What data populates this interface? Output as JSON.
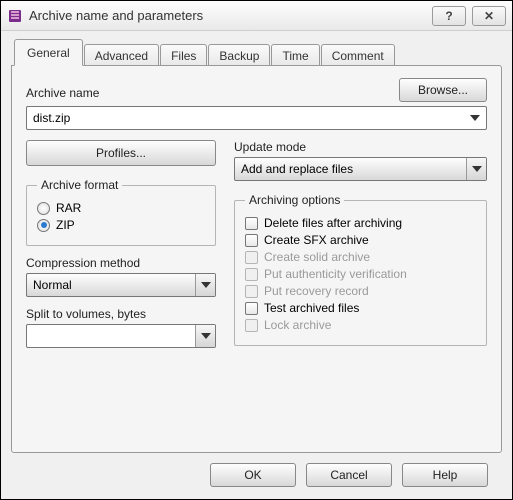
{
  "title": "Archive name and parameters",
  "tabs": [
    "General",
    "Advanced",
    "Files",
    "Backup",
    "Time",
    "Comment"
  ],
  "browse": "Browse...",
  "archive_name_label": "Archive name",
  "archive_name_value": "dist.zip",
  "profiles_btn": "Profiles...",
  "update_mode_label": "Update mode",
  "update_mode_value": "Add and replace files",
  "archive_format": {
    "legend": "Archive format",
    "options": [
      "RAR",
      "ZIP"
    ],
    "selected": "ZIP"
  },
  "compression_method_label": "Compression method",
  "compression_method_value": "Normal",
  "split_label": "Split to volumes, bytes",
  "split_value": "",
  "archiving_options": {
    "legend": "Archiving options",
    "items": [
      {
        "label": "Delete files after archiving",
        "disabled": false
      },
      {
        "label": "Create SFX archive",
        "disabled": false
      },
      {
        "label": "Create solid archive",
        "disabled": true
      },
      {
        "label": "Put authenticity verification",
        "disabled": true
      },
      {
        "label": "Put recovery record",
        "disabled": true
      },
      {
        "label": "Test archived files",
        "disabled": false
      },
      {
        "label": "Lock archive",
        "disabled": true
      }
    ]
  },
  "footer": {
    "ok": "OK",
    "cancel": "Cancel",
    "help": "Help"
  }
}
